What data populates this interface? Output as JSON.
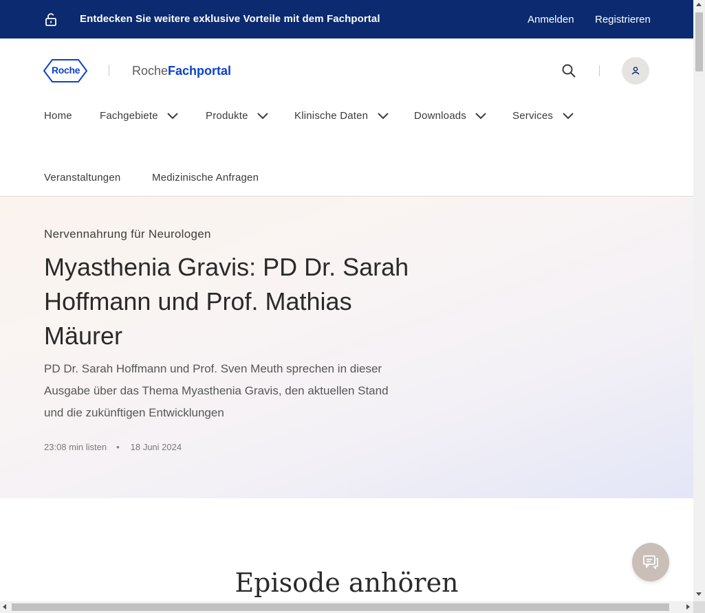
{
  "promo": {
    "message": "Entdecken Sie weitere exklusive Vorteile mit dem Fachportal",
    "login": "Anmelden",
    "register": "Registrieren",
    "icon": "unlock-icon"
  },
  "header": {
    "logo_text": "Roche",
    "brand_part1": "Roche",
    "brand_part2": "Fachportal"
  },
  "nav": {
    "items": [
      {
        "label": "Home"
      },
      {
        "label": "Fachgebiete"
      },
      {
        "label": "Produkte"
      },
      {
        "label": "Klinische Daten"
      },
      {
        "label": "Downloads"
      },
      {
        "label": "Services"
      },
      {
        "label": "Veranstaltungen"
      },
      {
        "label": "Medizinische Anfragen"
      }
    ]
  },
  "hero": {
    "eyebrow": "Nervennahrung für Neurologen",
    "title": "Myasthenia Gravis: PD Dr. Sarah Hoffmann und Prof. Mathias Mäurer",
    "description": "PD Dr. Sarah Hoffmann und Prof. Sven Meuth sprechen in dieser Ausgabe über das Thema Myasthenia Gravis, den aktuellen Stand und die zukünftigen Entwicklungen",
    "duration": "23:08 min listen",
    "date": "18 Juni 2024"
  },
  "episode": {
    "heading": "Episode anhören"
  },
  "colors": {
    "promo_bg": "#0b2a6f",
    "brand_blue": "#0b41cd",
    "chat_fab": "#c9bfb8"
  }
}
